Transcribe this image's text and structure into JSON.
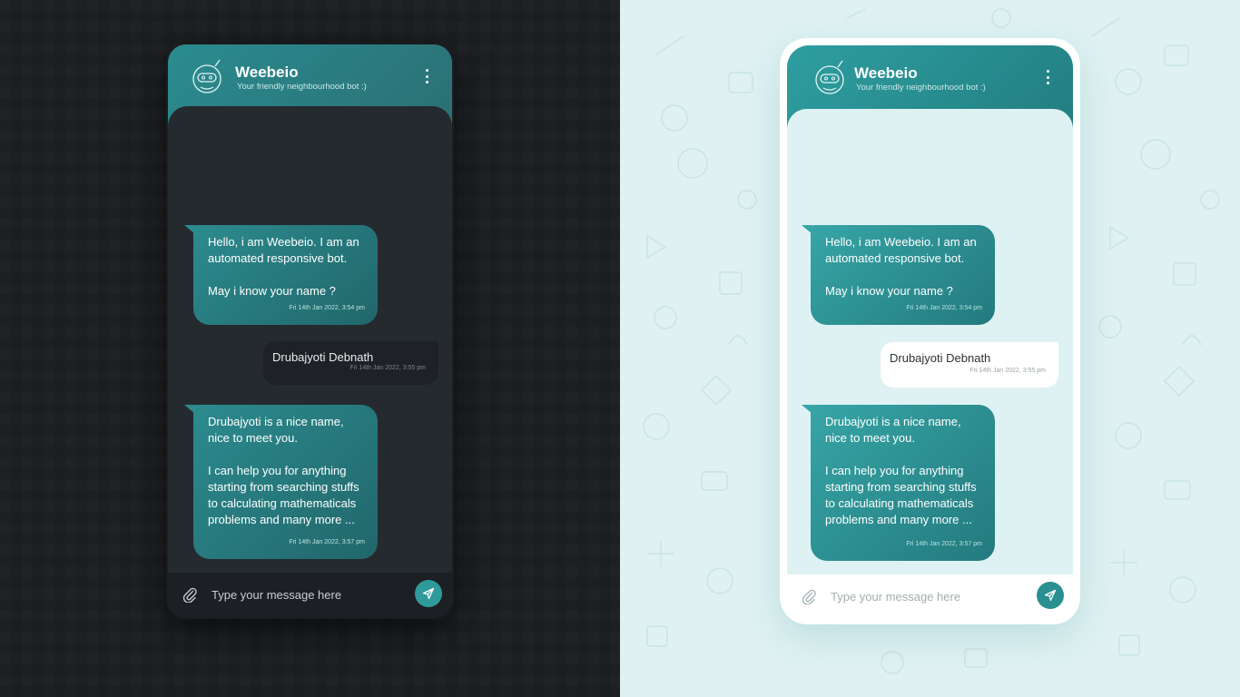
{
  "colors": {
    "dark_background": "#1d2022",
    "light_background": "#dff1f2",
    "accent_teal": "#2a8c8f",
    "dark_chat_area": "#252a2f",
    "light_chat_area": "#dff2f3"
  },
  "themes": [
    {
      "theme": "dark",
      "header": {
        "bot_name": "Weebeio",
        "tagline": "Your friendly neighbourhood bot :)",
        "avatar_icon": "robot-head-icon",
        "menu_icon": "kebab-menu-icon"
      },
      "messages": [
        {
          "sender": "bot",
          "text": "Hello, i am Weebeio. I am an\nautomated responsive bot.\n\nMay i know your name ?",
          "time": "Fri 14th Jan 2022, 3:54 pm"
        },
        {
          "sender": "user",
          "text": "Drubajyoti Debnath",
          "time": "Fri 14th Jan 2022, 3:55 pm"
        },
        {
          "sender": "bot",
          "text": "Drubajyoti is a nice name,\nnice to meet you.\n\nI can help you for anything\nstarting from searching stuffs\nto calculating mathematicals\nproblems and many more ...",
          "time": "Fri 14th Jan 2022, 3:57 pm"
        }
      ],
      "input": {
        "placeholder": "Type your message here",
        "value": "",
        "attach_icon": "paperclip-icon",
        "send_icon": "send-icon"
      }
    },
    {
      "theme": "light",
      "header": {
        "bot_name": "Weebeio",
        "tagline": "Your friendly neighbourhood bot :)",
        "avatar_icon": "robot-head-icon",
        "menu_icon": "kebab-menu-icon"
      },
      "messages": [
        {
          "sender": "bot",
          "text": "Hello, i am Weebeio. I am an\nautomated responsive bot.\n\nMay i know your name ?",
          "time": "Fri 14th Jan 2022, 3:54 pm"
        },
        {
          "sender": "user",
          "text": "Drubajyoti Debnath",
          "time": "Fri 14th Jan 2022, 3:55 pm"
        },
        {
          "sender": "bot",
          "text": "Drubajyoti is a nice name,\nnice to meet you.\n\nI can help you for anything\nstarting from searching stuffs\nto calculating mathematicals\nproblems and many more ...",
          "time": "Fri 14th Jan 2022, 3:57 pm"
        }
      ],
      "input": {
        "placeholder": "Type your message here",
        "value": "",
        "attach_icon": "paperclip-icon",
        "send_icon": "send-icon"
      }
    }
  ]
}
